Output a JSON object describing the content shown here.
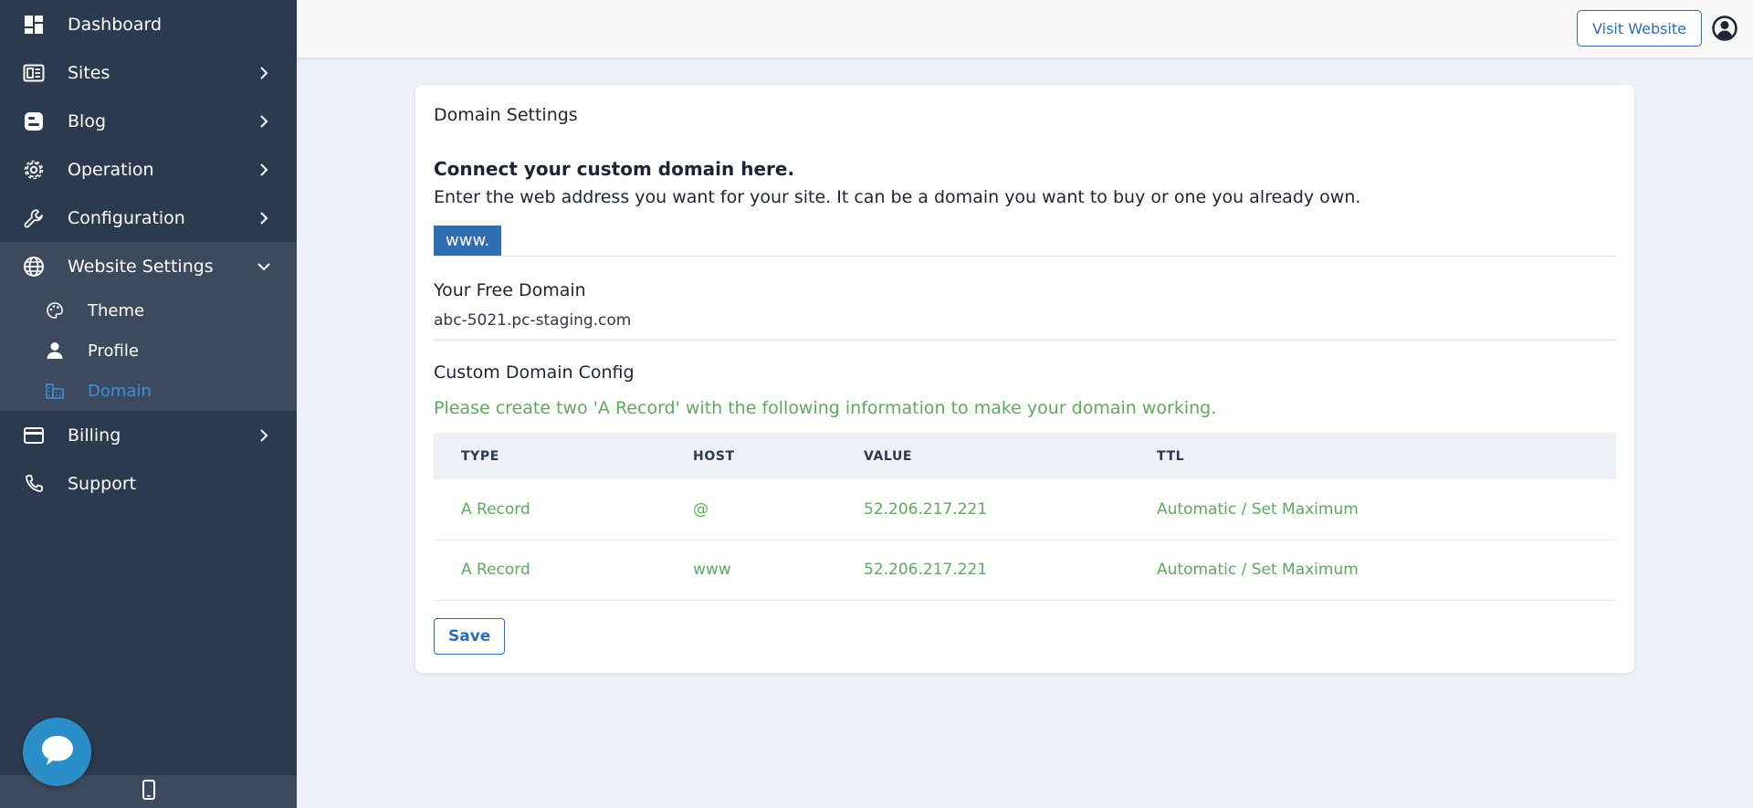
{
  "sidebar": {
    "items": [
      {
        "label": "Dashboard",
        "icon": "dashboard-icon"
      },
      {
        "label": "Sites",
        "icon": "sites-icon"
      },
      {
        "label": "Blog",
        "icon": "blog-icon"
      },
      {
        "label": "Operation",
        "icon": "gear-icon"
      },
      {
        "label": "Configuration",
        "icon": "wrench-icon"
      },
      {
        "label": "Website Settings",
        "icon": "globe-icon"
      },
      {
        "label": "Billing",
        "icon": "credit-card-icon"
      },
      {
        "label": "Support",
        "icon": "phone-icon"
      }
    ],
    "website_settings_subitems": [
      {
        "label": "Theme",
        "icon": "palette-icon"
      },
      {
        "label": "Profile",
        "icon": "person-icon"
      },
      {
        "label": "Domain",
        "icon": "domain-icon",
        "active": true
      }
    ]
  },
  "header": {
    "visit_website_label": "Visit Website"
  },
  "domain_settings": {
    "title": "Domain Settings",
    "connect_heading": "Connect your custom domain here.",
    "connect_description": "Enter the web address you want for your site. It can be a domain you want to buy or one you already own.",
    "www_prefix": "www.",
    "custom_domain_value": "",
    "free_domain_label": "Your Free Domain",
    "free_domain_value": "abc-5021.pc-staging.com",
    "custom_config_label": "Custom Domain Config",
    "custom_config_note": "Please create two 'A Record' with the following information to make your domain working.",
    "table": {
      "headers": [
        "TYPE",
        "HOST",
        "VALUE",
        "TTL"
      ],
      "rows": [
        [
          "A Record",
          "@",
          "52.206.217.221",
          "Automatic / Set Maximum"
        ],
        [
          "A Record",
          "www",
          "52.206.217.221",
          "Automatic / Set Maximum"
        ]
      ]
    },
    "save_label": "Save"
  },
  "colors": {
    "sidebar_bg": "#2c3a4f",
    "sidebar_group_bg": "#3d4a5e",
    "active_link": "#3d8fe0",
    "primary": "#2f6db3",
    "success_text": "#5fa95f",
    "page_bg": "#edf1f7",
    "chat_bubble": "#2b8ec9"
  }
}
